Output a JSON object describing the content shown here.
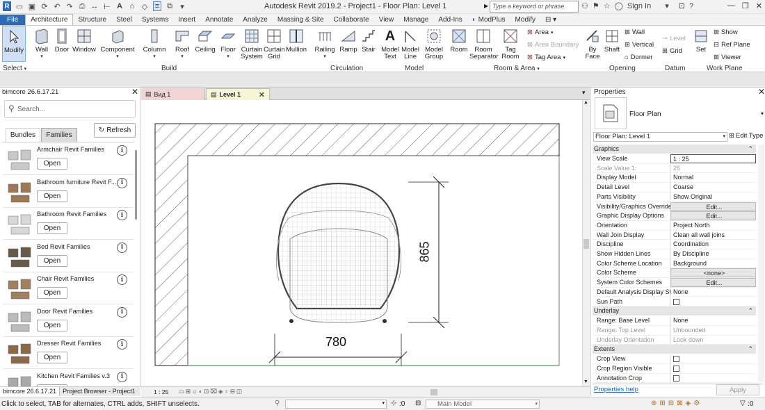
{
  "app": {
    "title": "Autodesk Revit 2019.2 - Project1 - Floor Plan: Level 1",
    "search_placeholder": "Type a keyword or phrase",
    "sign_in": "Sign In"
  },
  "tabs": [
    "File",
    "Architecture",
    "Structure",
    "Steel",
    "Systems",
    "Insert",
    "Annotate",
    "Analyze",
    "Massing & Site",
    "Collaborate",
    "View",
    "Manage",
    "Add-Ins",
    "ModPlus",
    "Modify"
  ],
  "ribbon": {
    "buttons": [
      {
        "label": "Modify",
        "icon": "cursor-icon"
      },
      {
        "label": "Wall",
        "icon": "wall-icon"
      },
      {
        "label": "Door",
        "icon": "door-icon"
      },
      {
        "label": "Window",
        "icon": "window-icon"
      },
      {
        "label": "Component",
        "icon": "component-icon"
      },
      {
        "label": "Column",
        "icon": "column-icon"
      },
      {
        "label": "Roof",
        "icon": "roof-icon"
      },
      {
        "label": "Ceiling",
        "icon": "ceiling-icon"
      },
      {
        "label": "Floor",
        "icon": "floor-icon"
      },
      {
        "label": "Curtain System",
        "icon": "curtain-system-icon"
      },
      {
        "label": "Curtain Grid",
        "icon": "curtain-grid-icon"
      },
      {
        "label": "Mullion",
        "icon": "mullion-icon"
      },
      {
        "label": "Railing",
        "icon": "railing-icon"
      },
      {
        "label": "Ramp",
        "icon": "ramp-icon"
      },
      {
        "label": "Stair",
        "icon": "stair-icon"
      },
      {
        "label": "Model Text",
        "icon": "model-text-icon"
      },
      {
        "label": "Model Line",
        "icon": "model-line-icon"
      },
      {
        "label": "Model Group",
        "icon": "model-group-icon"
      },
      {
        "label": "Room",
        "icon": "room-icon"
      },
      {
        "label": "Room Separator",
        "icon": "room-separator-icon"
      },
      {
        "label": "Tag Room",
        "icon": "tag-room-icon"
      },
      {
        "label": "By Face",
        "icon": "by-face-icon"
      },
      {
        "label": "Shaft",
        "icon": "shaft-icon"
      },
      {
        "label": "Set",
        "icon": "set-icon"
      }
    ],
    "small": {
      "area": "Area",
      "area_boundary": "Area Boundary",
      "tag_area": "Tag Area",
      "wall": "Wall",
      "vertical": "Vertical",
      "dormer": "Dormer",
      "level": "Level",
      "grid": "Grid",
      "show": "Show",
      "ref_plane": "Ref Plane",
      "viewer": "Viewer"
    },
    "groups": {
      "select": "Select",
      "build": "Build",
      "circulation": "Circulation",
      "model": "Model",
      "room_area": "Room & Area",
      "opening": "Opening",
      "datum": "Datum",
      "work_plane": "Work Plane"
    }
  },
  "left_panel": {
    "title": "bimcore 26.6.17.21",
    "search_placeholder": "Search...",
    "tab_bundles": "Bundles",
    "tab_families": "Families",
    "refresh": "Refresh",
    "families": [
      {
        "name": "Armchair Revit Families",
        "open": "Open"
      },
      {
        "name": "Bathroom furniture Revit F...",
        "open": "Open"
      },
      {
        "name": "Bathroom Revit Families",
        "open": "Open"
      },
      {
        "name": "Bed Revit Families",
        "open": "Open"
      },
      {
        "name": "Chair Revit Families",
        "open": "Open"
      },
      {
        "name": "Door Revit Families",
        "open": "Open"
      },
      {
        "name": "Dresser Revit Families",
        "open": "Open"
      },
      {
        "name": "Kitchen Revit Families v.3",
        "open": "Open"
      }
    ],
    "bottom_tab1": "bimcore 26.6.17.21",
    "bottom_tab2": "Project Browser - Project1"
  },
  "view_tabs": {
    "tab1": "Вид 1",
    "tab2": "Level 1"
  },
  "drawing": {
    "dim_width": "780",
    "dim_height": "865"
  },
  "view_control": {
    "scale": "1 : 25"
  },
  "properties": {
    "title": "Properties",
    "type_name": "Floor Plan",
    "selector": "Floor Plan: Level 1",
    "edit_type": "Edit Type",
    "sections": {
      "graphics": "Graphics",
      "underlay": "Underlay",
      "extents": "Extents"
    },
    "graphics_rows": [
      {
        "k": "View Scale",
        "v": "1 : 25"
      },
      {
        "k": "Scale Value    1:",
        "v": "25",
        "disabled": true
      },
      {
        "k": "Display Model",
        "v": "Normal"
      },
      {
        "k": "Detail Level",
        "v": "Coarse"
      },
      {
        "k": "Parts Visibility",
        "v": "Show Original"
      },
      {
        "k": "Visibility/Graphics Overrides",
        "v": "Edit...",
        "button": true
      },
      {
        "k": "Graphic Display Options",
        "v": "Edit...",
        "button": true
      },
      {
        "k": "Orientation",
        "v": "Project North"
      },
      {
        "k": "Wall Join Display",
        "v": "Clean all wall joins"
      },
      {
        "k": "Discipline",
        "v": "Coordination"
      },
      {
        "k": "Show Hidden Lines",
        "v": "By Discipline"
      },
      {
        "k": "Color Scheme Location",
        "v": "Background"
      },
      {
        "k": "Color Scheme",
        "v": "<none>",
        "button": true
      },
      {
        "k": "System Color Schemes",
        "v": "Edit...",
        "button": true
      },
      {
        "k": "Default Analysis Display St...",
        "v": "None"
      },
      {
        "k": "Sun Path",
        "v": "",
        "checkbox": true
      }
    ],
    "underlay_rows": [
      {
        "k": "Range: Base Level",
        "v": "None"
      },
      {
        "k": "Range: Top Level",
        "v": "Unbounded",
        "disabled": true
      },
      {
        "k": "Underlay Orientation",
        "v": "Look down",
        "disabled": true
      }
    ],
    "extents_rows": [
      {
        "k": "Crop View",
        "v": "",
        "checkbox": true
      },
      {
        "k": "Crop Region Visible",
        "v": "",
        "checkbox": true
      },
      {
        "k": "Annotation Crop",
        "v": "",
        "checkbox": true
      }
    ],
    "help": "Properties help",
    "apply": "Apply"
  },
  "status": {
    "hint": "Click to select, TAB for alternates, CTRL adds, SHIFT unselects.",
    "coord": ":0",
    "model": "Main Model",
    "filter": ":0"
  }
}
